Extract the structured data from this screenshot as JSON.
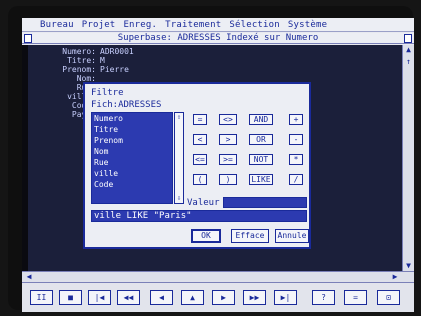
{
  "menubar": {
    "items": [
      "Bureau",
      "Projet",
      "Enreg.",
      "Traitement",
      "Sélection",
      "Système"
    ]
  },
  "window": {
    "title": "Superbase:  ADRESSES Indexé sur Numero"
  },
  "record": {
    "labels": [
      "Numero:",
      "Titre:",
      "Prenom:",
      "Nom:",
      "Rue:",
      "ville:",
      "Code:",
      "Pays:"
    ],
    "values": [
      "ADR0001",
      "M",
      "Pierre"
    ]
  },
  "dialog": {
    "title": "Filtre",
    "file": "Fich:ADRESSES",
    "fields": [
      "Numero",
      "Titre",
      "Prenom",
      "Nom",
      "Rue",
      "ville",
      "Code"
    ],
    "operators": {
      "row1": [
        "=",
        "<>",
        "AND",
        "+"
      ],
      "row2": [
        "<",
        ">",
        "OR",
        "-"
      ],
      "row3": [
        "<=",
        ">=",
        "NOT",
        "*"
      ],
      "row4": [
        "(",
        ")",
        "LIKE",
        "/"
      ]
    },
    "valeur_label": "Valeur",
    "valeur_value": "",
    "expression": "ville LIKE \"Paris\"",
    "ok_label": "OK",
    "efface_label": "Efface",
    "annule_label": "Annule"
  },
  "vcr": {
    "buttons": [
      "II",
      "■",
      "|◀",
      "◀◀",
      "◀",
      "▲",
      "▶",
      "▶▶",
      "▶|",
      "?",
      "=",
      "⊡"
    ]
  }
}
